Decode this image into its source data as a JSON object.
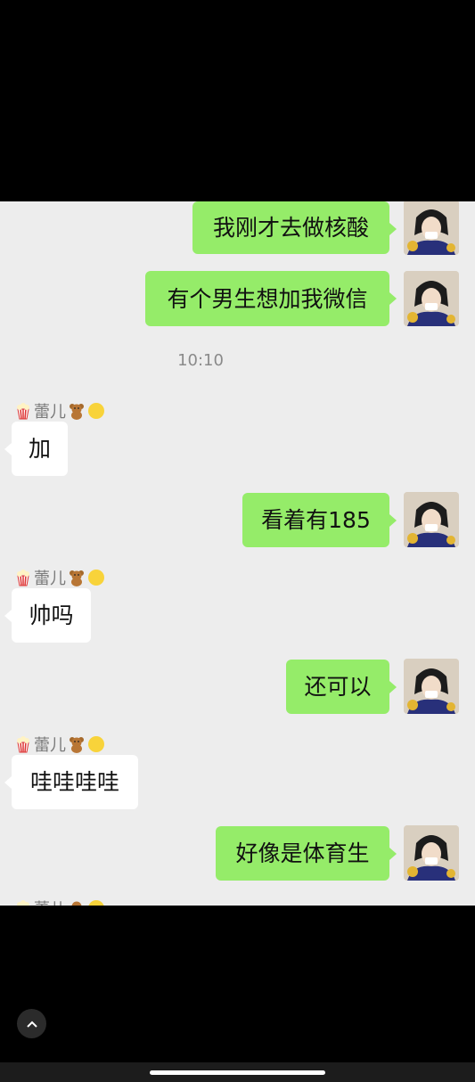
{
  "messages": [
    {
      "dir": "out",
      "text": "我刚才去做核酸"
    },
    {
      "dir": "out",
      "text": "有个男生想加我微信"
    },
    {
      "time": "10:10"
    },
    {
      "dir": "in",
      "sender": "蕾儿",
      "text": "加"
    },
    {
      "dir": "out",
      "text": "看着有185"
    },
    {
      "dir": "in",
      "sender": "蕾儿",
      "text": "帅吗"
    },
    {
      "dir": "out",
      "text": "还可以"
    },
    {
      "dir": "in",
      "sender": "蕾儿",
      "text": "哇哇哇哇"
    },
    {
      "dir": "out",
      "text": "好像是体育生"
    },
    {
      "dir": "in",
      "sender": "蕾儿"
    }
  ],
  "icons": {
    "sender_prefix": "popcorn-icon",
    "sender_suffix": [
      "teddy-bear-icon",
      "yellow-circle-icon"
    ],
    "scroll_button": "chevron-up-icon"
  },
  "colors": {
    "outgoing": "#95ec69",
    "incoming": "#ffffff",
    "chat_bg": "#ededed"
  }
}
